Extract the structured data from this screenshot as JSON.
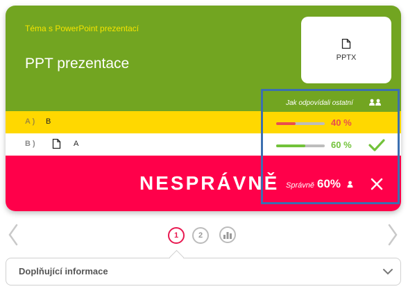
{
  "header": {
    "topic": "Téma s PowerPoint prezentací",
    "title": "PPT prezentace",
    "file_label": "PPTX",
    "bg_color": "#72a521"
  },
  "answers": [
    {
      "letter": "A )",
      "text": "B",
      "percent": 40,
      "percent_label": "40 %",
      "color": "#e84e4e",
      "row_bg": "#ffd800",
      "correct": false
    },
    {
      "letter": "B )",
      "text": "A",
      "percent": 60,
      "percent_label": "60 %",
      "color": "#72c23a",
      "row_bg": "#ffffff",
      "correct": true
    }
  ],
  "stats": {
    "heading": "Jak odpovídali ostatní",
    "correct_label": "Správně",
    "correct_value": "60%"
  },
  "verdict": {
    "text": "NESPRÁVNĚ",
    "bg_color": "#ff004a"
  },
  "pager": {
    "pages": [
      "1",
      "2"
    ],
    "active": "1"
  },
  "info": {
    "label": "Doplňující informace"
  },
  "icons": [
    "file-icon",
    "people-icon",
    "person-icon",
    "check-icon",
    "close-icon",
    "chevron-left-icon",
    "chevron-right-icon",
    "chart-icon",
    "chevron-down-icon"
  ]
}
